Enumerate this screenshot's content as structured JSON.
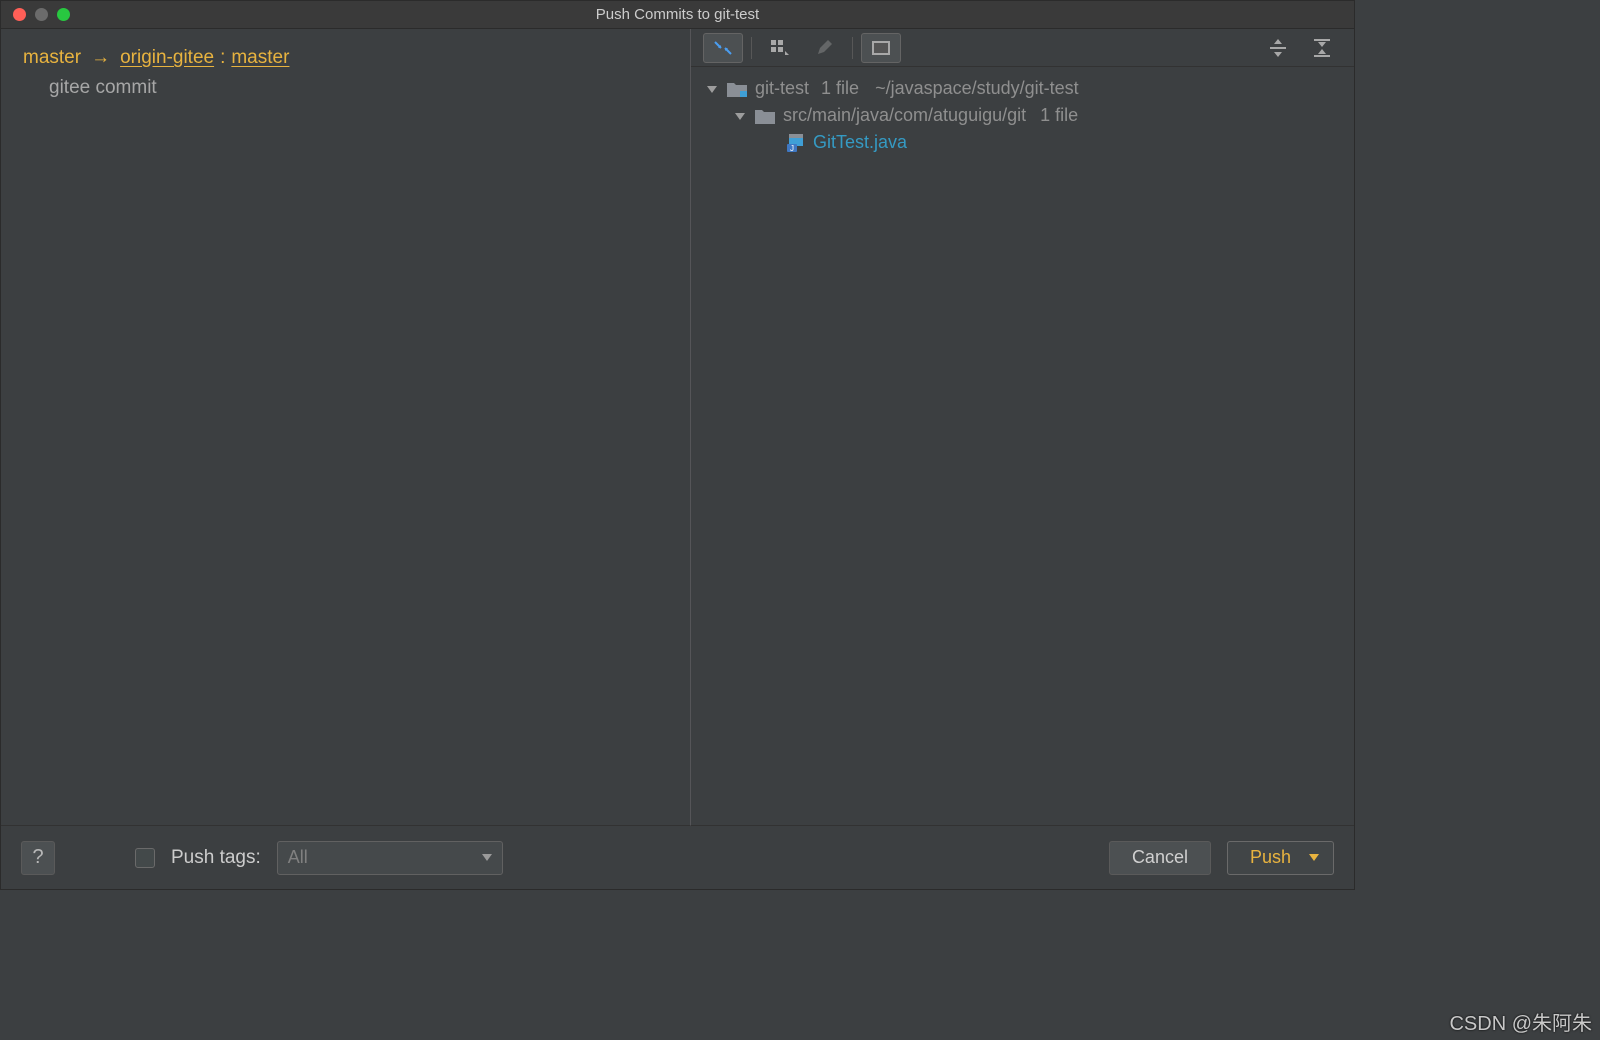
{
  "window": {
    "title": "Push Commits to git-test"
  },
  "left": {
    "local_branch": "master",
    "arrow": "→",
    "remote_name": "origin-gitee",
    "colon": " : ",
    "remote_branch": "master",
    "commits": [
      "gitee commit"
    ]
  },
  "tree": {
    "root": {
      "name": "git-test",
      "count_label": "1 file",
      "path": "~/javaspace/study/git-test"
    },
    "dir": {
      "name": "src/main/java/com/atuguigu/git",
      "count_label": "1 file"
    },
    "file": {
      "name": "GitTest.java"
    }
  },
  "footer": {
    "help": "?",
    "push_tags_label": "Push tags:",
    "select_value": "All",
    "cancel_label": "Cancel",
    "push_label": "Push"
  },
  "watermark": "CSDN @朱阿朱",
  "icons": {
    "collapse": "collapse-arrows-icon",
    "group": "group-by-icon",
    "edit": "edit-icon",
    "preview": "preview-diff-icon",
    "expand_all": "expand-all-icon",
    "collapse_all": "collapse-all-icon"
  }
}
